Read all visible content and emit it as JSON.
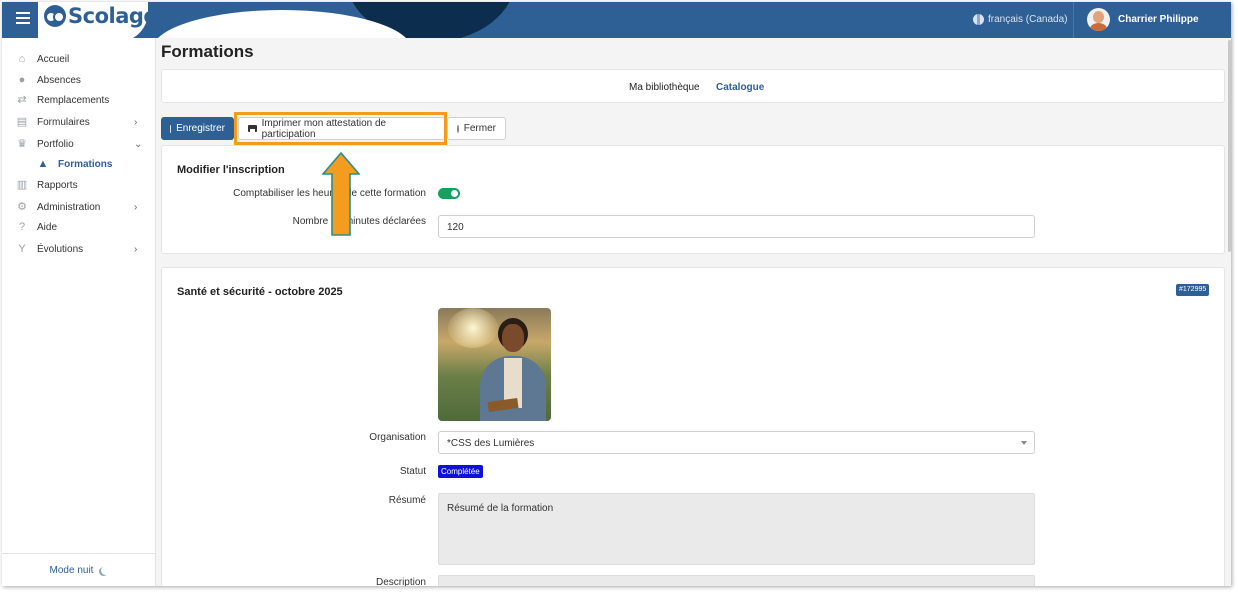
{
  "header": {
    "app_name": "Scolago",
    "language": "français (Canada)",
    "user_name": "Charrier Philippe"
  },
  "sidebar": {
    "items": [
      {
        "label": "Accueil",
        "icon": "home-icon"
      },
      {
        "label": "Absences",
        "icon": "users-icon"
      },
      {
        "label": "Remplacements",
        "icon": "swap-icon"
      },
      {
        "label": "Formulaires",
        "icon": "file-icon",
        "has_children": true
      },
      {
        "label": "Portfolio",
        "icon": "trophy-icon",
        "has_children": true,
        "expanded": true
      },
      {
        "label": "Formations",
        "icon": "graduation-cap-icon",
        "active": true
      },
      {
        "label": "Rapports",
        "icon": "building-icon"
      },
      {
        "label": "Administration",
        "icon": "gear-icon",
        "has_children": true
      },
      {
        "label": "Aide",
        "icon": "question-icon"
      },
      {
        "label": "Évolutions",
        "icon": "sprout-icon",
        "has_children": true
      }
    ],
    "night_mode_label": "Mode nuit"
  },
  "page": {
    "title": "Formations",
    "tabs": [
      "Ma bibliothèque",
      "Catalogue"
    ]
  },
  "toolbar": {
    "save_label": "Enregistrer",
    "print_label": "Imprimer mon attestation de participation",
    "close_label": "Fermer"
  },
  "registration": {
    "heading": "Modifier l'inscription",
    "count_hours_label": "Comptabiliser les heures de cette formation",
    "count_hours_enabled": true,
    "minutes_label": "Nombre de minutes déclarées",
    "minutes_value": "120"
  },
  "training": {
    "title": "Santé et sécurité - octobre 2025",
    "id_badge": "#172995",
    "organisation_label": "Organisation",
    "organisation_value": "*CSS des Lumières",
    "status_label": "Statut",
    "status_value": "Complétée",
    "summary_label": "Résumé",
    "summary_value": "Résumé de la formation",
    "description_label": "Description"
  },
  "colors": {
    "primary": "#2e5f95",
    "highlight": "#f29b1d",
    "arrow": "#f39c1f",
    "toggle_on": "#17a05d",
    "status": "#1010d8"
  }
}
